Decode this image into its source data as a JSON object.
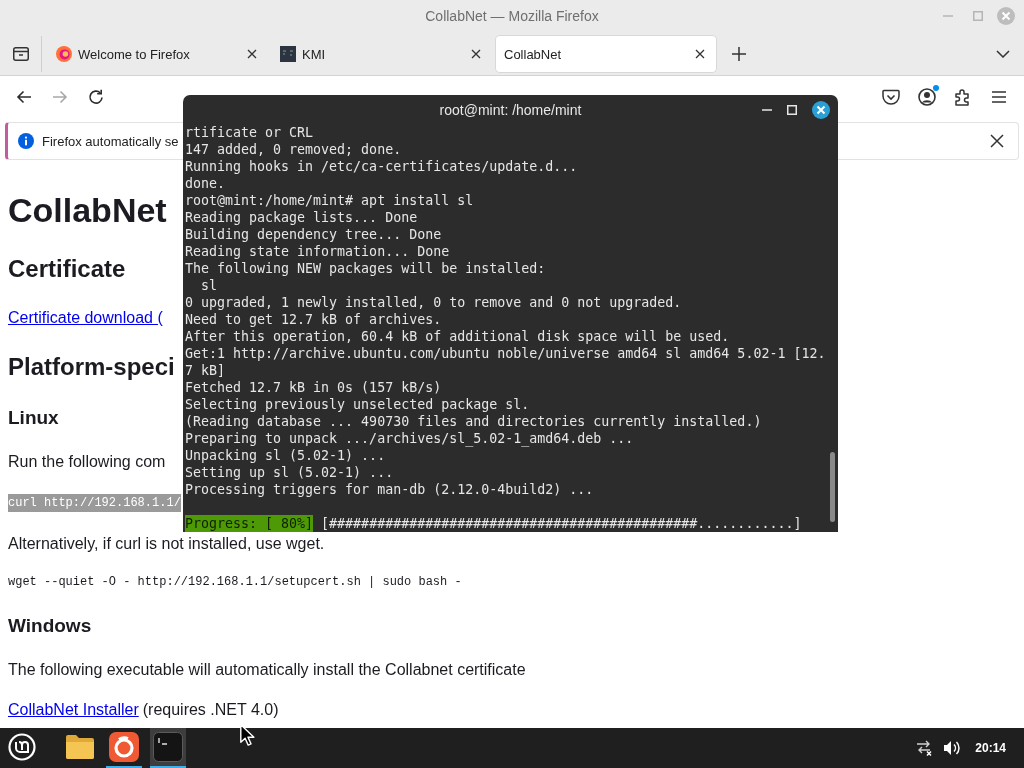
{
  "window": {
    "title": "CollabNet — Mozilla Firefox"
  },
  "tabs": [
    {
      "title": "Welcome to Firefox",
      "kind": "firefox",
      "selected": false
    },
    {
      "title": "KMI",
      "kind": "dark-square",
      "selected": false
    },
    {
      "title": "CollabNet",
      "kind": "plain",
      "selected": true
    }
  ],
  "nav_buttons": [
    {
      "kind": "back",
      "disabled": false
    },
    {
      "kind": "forward",
      "disabled": true
    },
    {
      "kind": "reload",
      "disabled": false
    }
  ],
  "toolbar_icons": [
    {
      "kind": "pocket",
      "badge": false
    },
    {
      "kind": "account",
      "badge": true
    },
    {
      "kind": "extensions",
      "badge": false
    },
    {
      "kind": "menu",
      "badge": false
    }
  ],
  "notification": {
    "text": "Firefox automatically se"
  },
  "page": {
    "blocks": [
      {
        "kind": "heading1",
        "text": "CollabNet"
      },
      {
        "kind": "heading2",
        "text": "Certificate"
      },
      {
        "kind": "link",
        "text": "Certificate download ("
      },
      {
        "kind": "heading2",
        "text": "Platform-speci"
      },
      {
        "kind": "heading3",
        "text": "Linux"
      },
      {
        "kind": "paragraph",
        "text": "Run the following com"
      },
      {
        "kind": "code_highlight",
        "text": "curl http://192.168.1.1/"
      },
      {
        "kind": "paragraph",
        "text": "Alternatively, if curl is not installed, use wget."
      },
      {
        "kind": "code",
        "text": "wget --quiet -O - http://192.168.1.1/setupcert.sh | sudo bash -"
      },
      {
        "kind": "heading3",
        "text": "Windows"
      },
      {
        "kind": "paragraph",
        "text": "The following executable will automatically install the Collabnet certificate"
      },
      {
        "kind": "link_paragraph",
        "link": "CollabNet Installer",
        "text": "(requires .NET 4.0)"
      }
    ]
  },
  "terminal": {
    "title": "root@mint: /home/mint",
    "lines": [
      "rtificate or CRL",
      "147 added, 0 removed; done.",
      "Running hooks in /etc/ca-certificates/update.d...",
      "done.",
      "root@mint:/home/mint# apt install sl",
      "Reading package lists... Done",
      "Building dependency tree... Done",
      "Reading state information... Done",
      "The following NEW packages will be installed:",
      "  sl",
      "0 upgraded, 1 newly installed, 0 to remove and 0 not upgraded.",
      "Need to get 12.7 kB of archives.",
      "After this operation, 60.4 kB of additional disk space will be used.",
      "Get:1 http://archive.ubuntu.com/ubuntu noble/universe amd64 sl amd64 5.02-1 [12.",
      "7 kB]",
      "Fetched 12.7 kB in 0s (157 kB/s)",
      "Selecting previously unselected package sl.",
      "(Reading database ... 490730 files and directories currently installed.)",
      "Preparing to unpack .../archives/sl_5.02-1_amd64.deb ...",
      "Unpacking sl (5.02-1) ...",
      "Setting up sl (5.02-1) ...",
      "Processing triggers for man-db (2.12.0-4build2) ..."
    ],
    "progress": {
      "label": "Progress: [ 80%]",
      "bar": "[##############################################............]"
    }
  },
  "taskbar": {
    "apps": [
      {
        "kind": "menu",
        "running": false,
        "selected": false
      },
      {
        "kind": "folder",
        "running": false,
        "selected": false
      },
      {
        "kind": "firefox",
        "running": true,
        "selected": false
      },
      {
        "kind": "terminal",
        "running": true,
        "selected": true
      }
    ],
    "clock": "20:14"
  }
}
